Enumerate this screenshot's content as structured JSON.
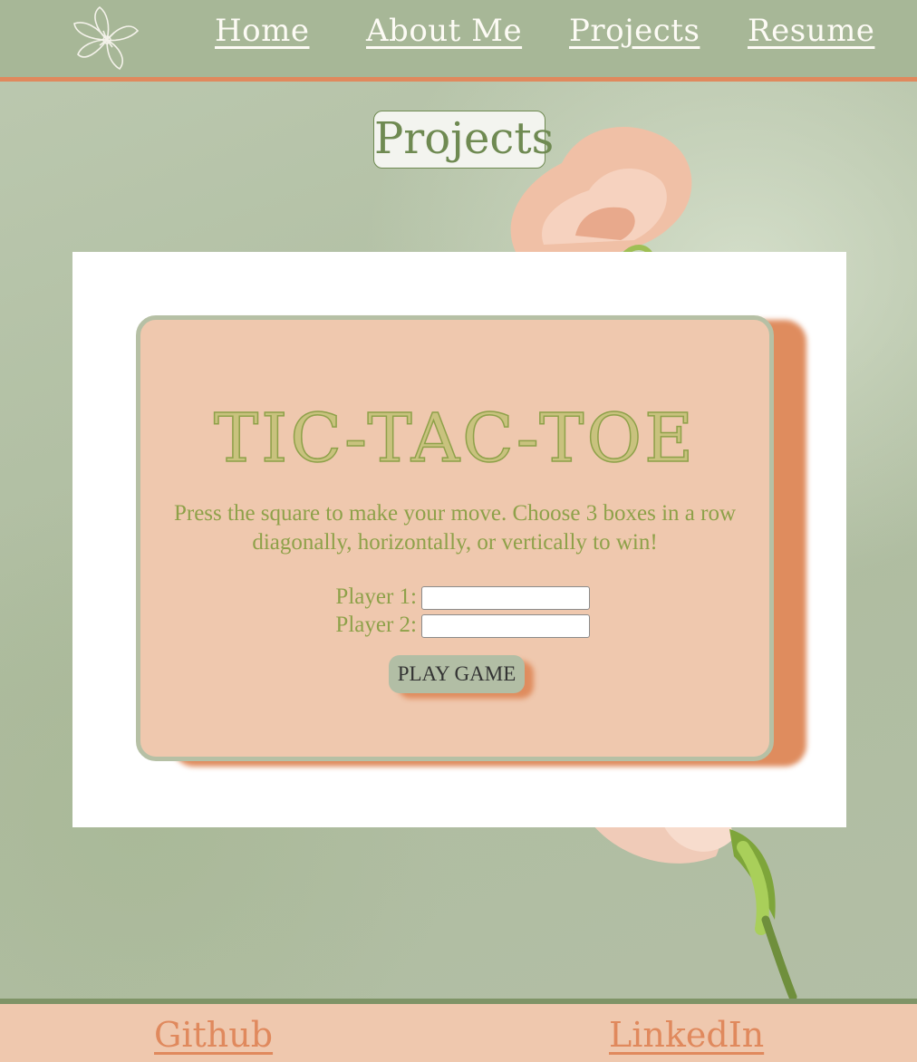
{
  "nav": {
    "logo": "flower-logo-icon",
    "items": [
      "Home",
      "About Me",
      "Projects",
      "Resume"
    ]
  },
  "page": {
    "title": "Projects"
  },
  "game": {
    "title": "TIC-TAC-TOE",
    "instructions": "Press the square to make your move. Choose 3 boxes in a row diagonally, horizontally, or vertically to win!",
    "player1_label": "Player 1:",
    "player1_value": "",
    "player2_label": "Player 2:",
    "player2_value": "",
    "play_button": "PLAY GAME"
  },
  "footer": {
    "links": [
      "Github",
      "LinkedIn"
    ]
  },
  "colors": {
    "header": "#a7b797",
    "accent": "#e0895d",
    "card": "#efc8ae",
    "text_green": "#8ea149"
  }
}
